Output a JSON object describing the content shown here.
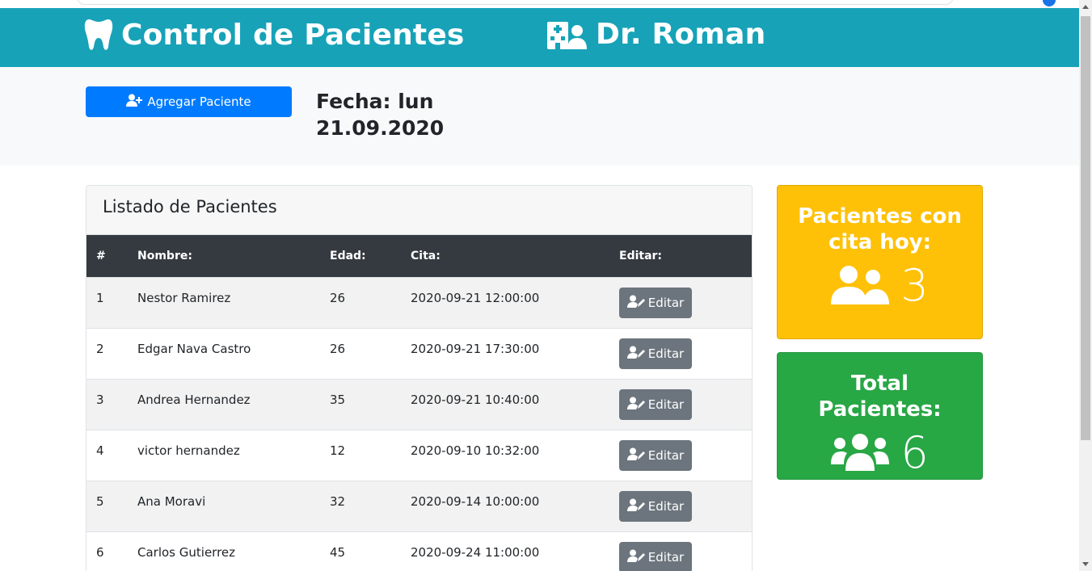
{
  "header": {
    "title": "Control de Pacientes",
    "doctor": "Dr. Roman",
    "brand_icon": "tooth-icon",
    "doctor_icon": "hospital-user-icon"
  },
  "toolbar": {
    "add_button_label": "Agregar Paciente",
    "add_button_icon": "user-plus-icon",
    "fecha_line1": "Fecha: lun",
    "fecha_line2": "21.09.2020"
  },
  "patients_card": {
    "title": "Listado de Pacientes",
    "columns": [
      "#",
      "Nombre:",
      "Edad:",
      "Cita:",
      "Editar:"
    ],
    "edit_label": "Editar",
    "edit_icon": "user-edit-icon",
    "rows": [
      {
        "id": "1",
        "name": "Nestor Ramirez",
        "age": "26",
        "cita": "2020-09-21 12:00:00"
      },
      {
        "id": "2",
        "name": "Edgar Nava Castro",
        "age": "26",
        "cita": "2020-09-21 17:30:00"
      },
      {
        "id": "3",
        "name": "Andrea Hernandez",
        "age": "35",
        "cita": "2020-09-21 10:40:00"
      },
      {
        "id": "4",
        "name": "victor hernandez",
        "age": "12",
        "cita": "2020-09-10 10:32:00"
      },
      {
        "id": "5",
        "name": "Ana Moravi",
        "age": "32",
        "cita": "2020-09-14 10:00:00"
      },
      {
        "id": "6",
        "name": "Carlos Gutierrez",
        "age": "45",
        "cita": "2020-09-24 11:00:00"
      }
    ]
  },
  "stats": {
    "today": {
      "title": "Pacientes con cita hoy:",
      "value": "3",
      "icon": "user-friends-icon",
      "color": "#ffc107"
    },
    "total": {
      "title": "Total Pacientes:",
      "value": "6",
      "icon": "users-icon",
      "color": "#28a745"
    }
  },
  "colors": {
    "header": "#17a2b8",
    "primary": "#007bff",
    "secondary": "#6c757d",
    "dark": "#343a40"
  }
}
